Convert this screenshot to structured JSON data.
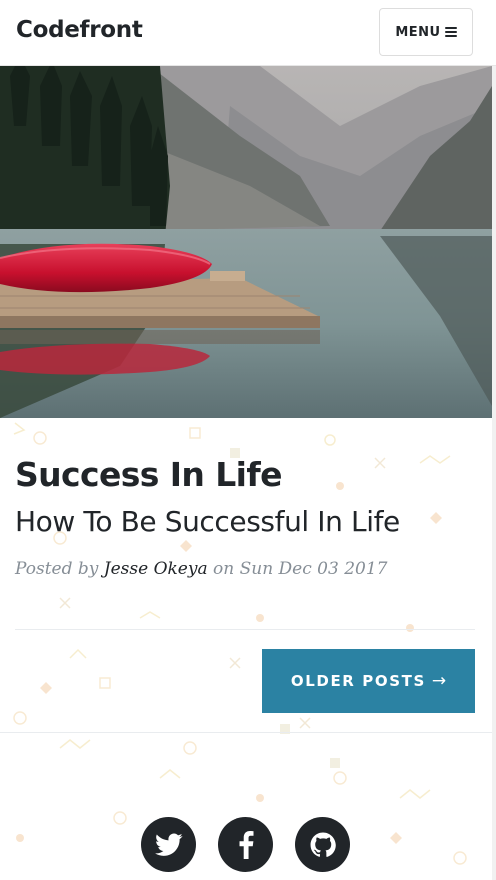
{
  "navbar": {
    "brand": "Codefront",
    "menu_label": "MENU",
    "menu_icon": "hamburger-icon"
  },
  "hero": {
    "image": "lake-with-red-canoe-on-dock"
  },
  "post": {
    "title": "Success In Life",
    "subtitle": "How To Be Successful In Life",
    "meta_prefix": "Posted by",
    "author": "Jesse Okeya",
    "meta_on": "on",
    "date": "Sun Dec 03 2017"
  },
  "pager": {
    "older_label": "OLDER POSTS",
    "older_arrow": "→"
  },
  "social": [
    {
      "name": "twitter",
      "icon": "twitter-icon"
    },
    {
      "name": "facebook",
      "icon": "facebook-icon"
    },
    {
      "name": "github",
      "icon": "github-icon"
    }
  ],
  "colors": {
    "accent": "#2b82a3",
    "text": "#212529",
    "muted": "#868e96"
  }
}
